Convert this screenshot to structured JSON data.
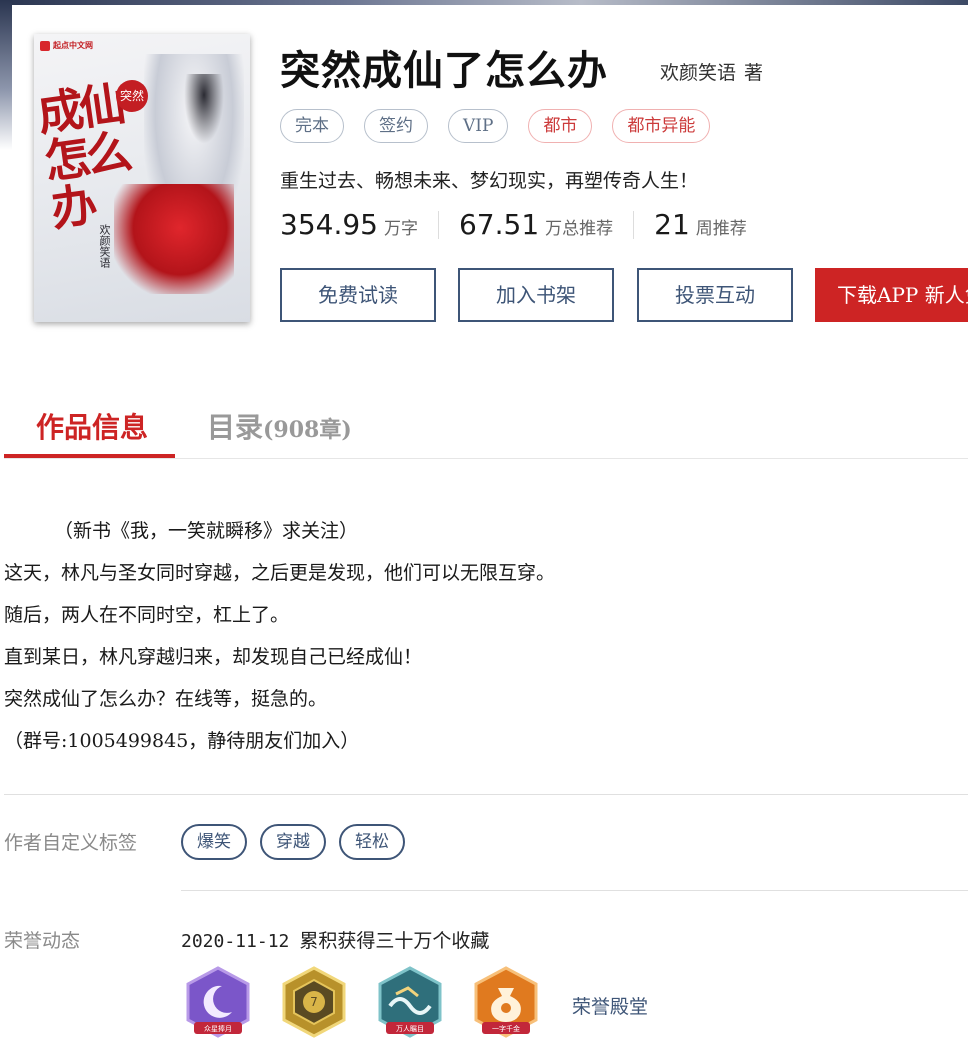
{
  "cover": {
    "logo_text": "起点中文网",
    "calligraphy": "成仙怎么办",
    "seal_text": "突然",
    "author_vertical": "欢颜笑语"
  },
  "book": {
    "title": "突然成仙了怎么办",
    "author": "欢颜笑语",
    "author_suffix": "著",
    "tags": [
      {
        "label": "完本",
        "style": "gray"
      },
      {
        "label": "签约",
        "style": "gray"
      },
      {
        "label": "VIP",
        "style": "gray"
      },
      {
        "label": "都市",
        "style": "red"
      },
      {
        "label": "都市异能",
        "style": "red"
      }
    ],
    "intro": "重生过去、畅想未来、梦幻现实，再塑传奇人生！",
    "stats": [
      {
        "value": "354.95",
        "unit": "万字"
      },
      {
        "value": "67.51",
        "unit": "万总推荐"
      },
      {
        "value": "21",
        "unit": "周推荐"
      }
    ]
  },
  "actions": {
    "free_read": "免费试读",
    "add_shelf": "加入书架",
    "vote": "投票互动",
    "download_app": "下载APP 新人免"
  },
  "tabs": {
    "info": "作品信息",
    "toc": "目录",
    "toc_count": "(908章)"
  },
  "description": [
    "（新书《我，一笑就瞬移》求关注）",
    "这天，林凡与圣女同时穿越，之后更是发现，他们可以无限互穿。",
    "随后，两人在不同时空，杠上了。",
    "直到某日，林凡穿越归来，却发现自己已经成仙！",
    "突然成仙了怎么办？在线等，挺急的。",
    "（群号:1005499845，静待朋友们加入）"
  ],
  "custom_tags": {
    "label": "作者自定义标签",
    "items": [
      "爆笑",
      "穿越",
      "轻松"
    ]
  },
  "honor": {
    "label": "荣誉动态",
    "date": "2020-11-12",
    "text": "累积获得三十万个收藏",
    "badges": [
      {
        "icon": "moon-badge-icon",
        "caption": "众星捧月",
        "color": "#7b56c9"
      },
      {
        "icon": "gold-medal-badge-icon",
        "caption": "",
        "color": "#b8912a"
      },
      {
        "icon": "wave-badge-icon",
        "caption": "万人瞩目",
        "color": "#2f6f7b"
      },
      {
        "icon": "money-bag-badge-icon",
        "caption": "一字千金",
        "color": "#e07a1f"
      }
    ],
    "hall_link": "荣誉殿堂"
  }
}
